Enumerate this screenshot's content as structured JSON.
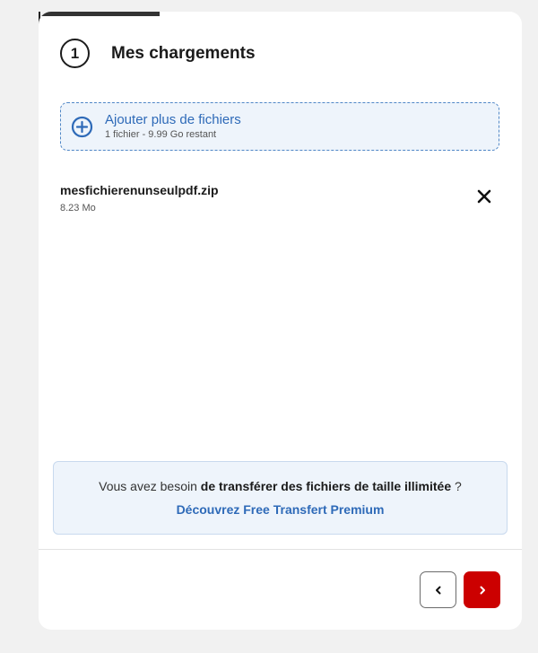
{
  "progress": {
    "fraction": 0.25
  },
  "step": {
    "number": "1",
    "title": "Mes chargements"
  },
  "add_files": {
    "label": "Ajouter plus de fichiers",
    "sublabel": "1 fichier - 9.99 Go restant",
    "icon": "plus-circle-icon"
  },
  "files": [
    {
      "name": "mesfichierenunseulpdf.zip",
      "size": "8.23 Mo"
    }
  ],
  "premium": {
    "text_prefix": "Vous avez besoin ",
    "text_bold": "de transférer des fichiers de taille illimitée",
    "text_suffix": " ?",
    "link": "Découvrez Free Transfert Premium"
  },
  "nav": {
    "prev_icon": "chevron-left-icon",
    "next_icon": "chevron-right-icon"
  },
  "colors": {
    "accent": "#2e6ab8",
    "primary_action": "#cc0000",
    "dropzone_bg": "#eef4fb"
  }
}
